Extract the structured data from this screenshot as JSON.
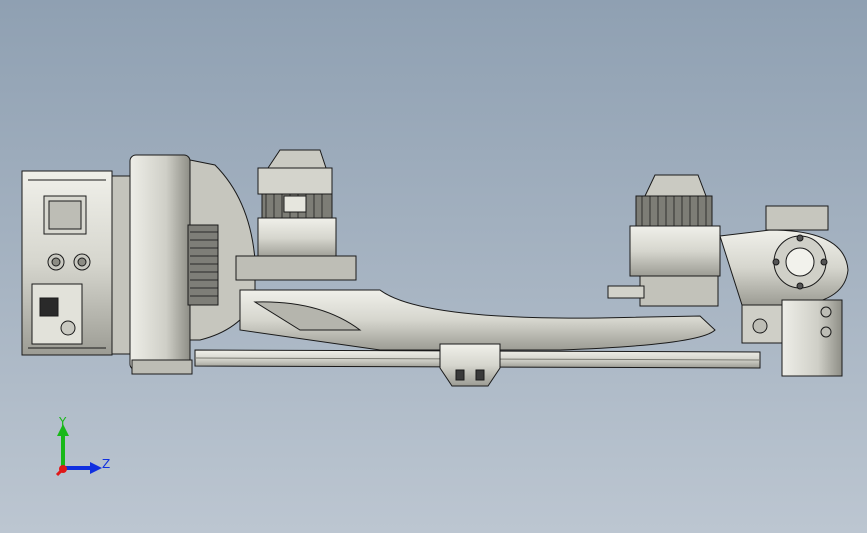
{
  "viewport": {
    "background_top": "#8fa0b2",
    "background_bottom": "#bcc6d1",
    "model_fill": "#dcdcd4",
    "model_shade": "#a8a8a0",
    "model_edge": "#1a1a1a"
  },
  "triad": {
    "y_label": "Y",
    "z_label": "Z",
    "y_color": "#18b818",
    "z_color": "#1030e0",
    "origin_color": "#e01818"
  }
}
